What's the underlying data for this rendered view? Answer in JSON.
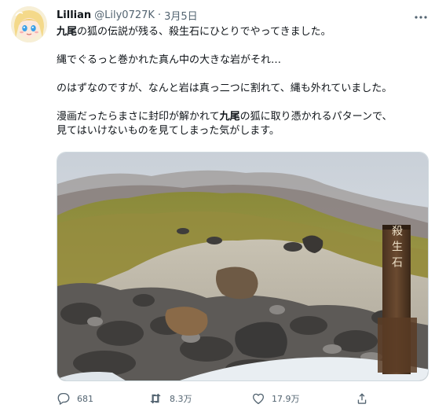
{
  "tweet": {
    "display_name": "Lillian",
    "handle": "@Lily0727K",
    "separator": "·",
    "time": "3月5日",
    "lines": [
      {
        "pre": "",
        "bold": "九尾",
        "post": "の狐の伝説が残る、殺生石にひとりでやってきました。"
      },
      {
        "pre": "縄でぐるっと巻かれた真ん中の大きな岩がそれ…",
        "bold": "",
        "post": ""
      },
      {
        "pre": "のはずなのですが、なんと岩は真っ二つに割れて、縄も外れていました。",
        "bold": "",
        "post": ""
      },
      {
        "pre": "漫画だったらまさに封印が解かれて",
        "bold": "九尾",
        "post": "の狐に取り憑かれるパターンで、"
      },
      {
        "pre": "見てはいけないものを見てしまった気がします。",
        "bold": "",
        "post": ""
      }
    ],
    "signpost_text": "殺生石"
  },
  "actions": {
    "reply_count": "681",
    "retweet_count": "8.3万",
    "like_count": "17.9万",
    "icons": [
      "reply-icon",
      "retweet-icon",
      "like-icon",
      "share-icon"
    ]
  },
  "colors": {
    "text": "#0f1419",
    "secondary": "#536471",
    "border": "#cfd9de"
  }
}
